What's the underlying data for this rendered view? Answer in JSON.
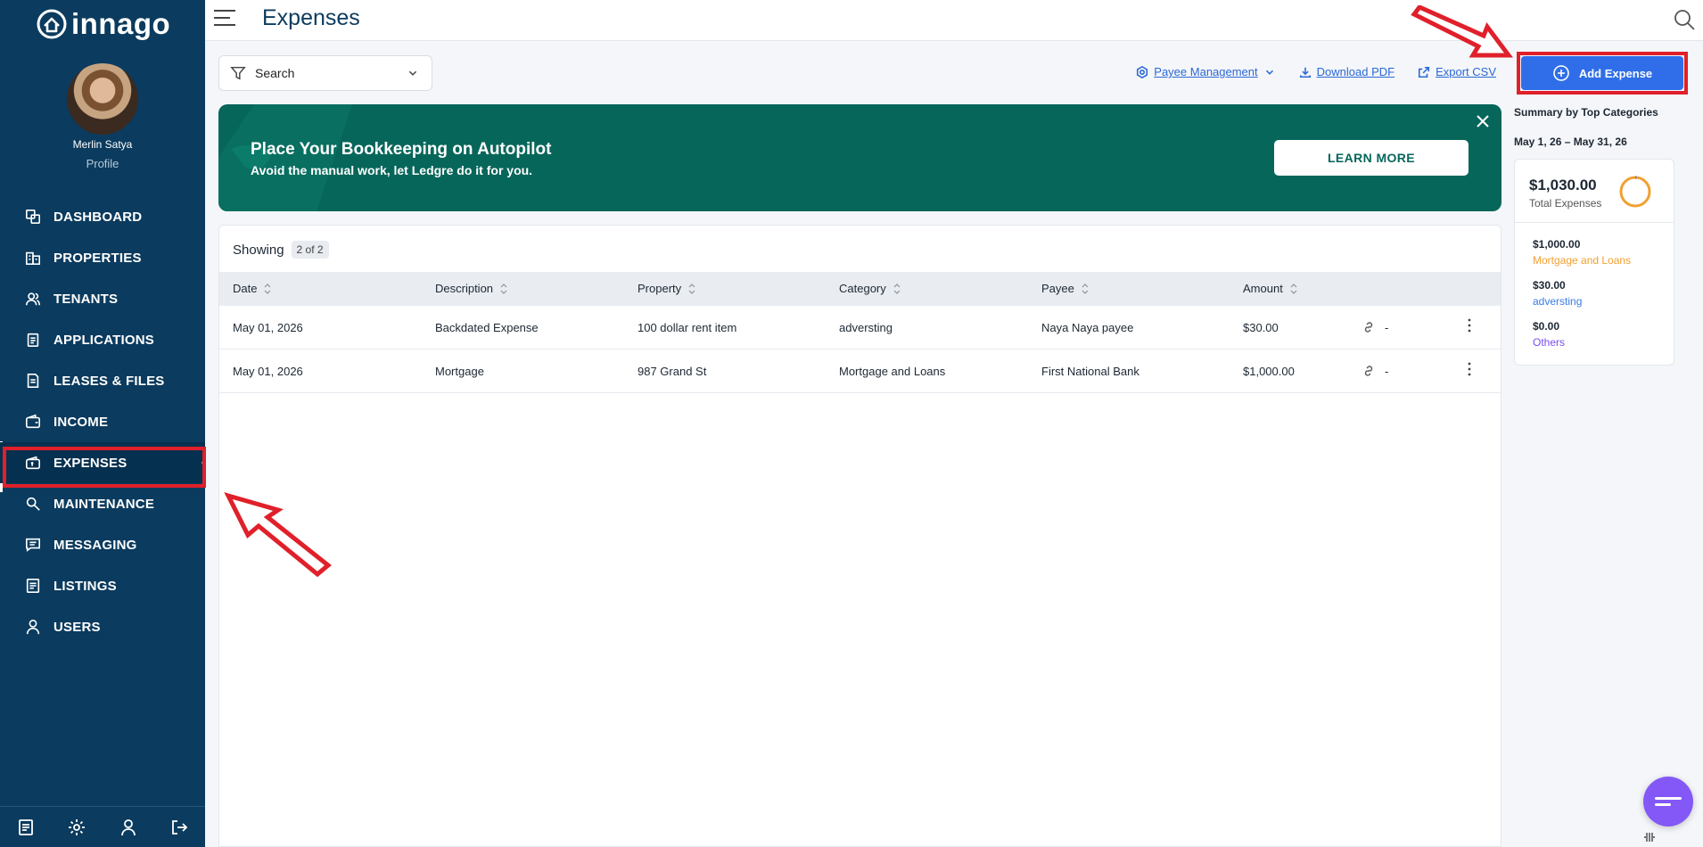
{
  "app": {
    "logo_text": "innago",
    "page_title": "Expenses"
  },
  "user": {
    "name": "Merlin Satya",
    "role": "Profile"
  },
  "nav": [
    {
      "label": "DASHBOARD",
      "icon": "dashboard-icon"
    },
    {
      "label": "PROPERTIES",
      "icon": "building-icon"
    },
    {
      "label": "TENANTS",
      "icon": "users-icon"
    },
    {
      "label": "APPLICATIONS",
      "icon": "clipboard-icon"
    },
    {
      "label": "LEASES & FILES",
      "icon": "file-icon"
    },
    {
      "label": "INCOME",
      "icon": "wallet-icon"
    },
    {
      "label": "EXPENSES",
      "icon": "expense-wallet-icon",
      "active": true
    },
    {
      "label": "MAINTENANCE",
      "icon": "wrench-icon"
    },
    {
      "label": "MESSAGING",
      "icon": "message-icon"
    },
    {
      "label": "LISTINGS",
      "icon": "list-icon"
    },
    {
      "label": "USERS",
      "icon": "user-icon"
    }
  ],
  "toolbar": {
    "search_label": "Search",
    "payee_management": "Payee Management",
    "download_pdf": "Download PDF",
    "export_csv": "Export CSV",
    "add_expense": "Add Expense"
  },
  "banner": {
    "title": "Place Your Bookkeeping on Autopilot",
    "subtitle": "Avoid the manual work, let Ledgre do it for you.",
    "button": "LEARN MORE"
  },
  "table": {
    "showing_label": "Showing",
    "count": "2 of 2",
    "columns": [
      "Date",
      "Description",
      "Property",
      "Category",
      "Payee",
      "Amount"
    ],
    "rows": [
      {
        "date": "May 01, 2026",
        "description": "Backdated Expense",
        "property": "100 dollar rent item",
        "category": "adversting",
        "payee": "Naya Naya payee",
        "amount": "$30.00",
        "link": "-"
      },
      {
        "date": "May 01, 2026",
        "description": "Mortgage",
        "property": "987 Grand St",
        "category": "Mortgage and Loans",
        "payee": "First National Bank",
        "amount": "$1,000.00",
        "link": "-"
      }
    ]
  },
  "summary": {
    "heading": "Summary by Top Categories",
    "range": "May 1, 26 – May 31, 26",
    "total": "$1,030.00",
    "total_label": "Total Expenses",
    "items": [
      {
        "amount": "$1,000.00",
        "category": "Mortgage and Loans",
        "color": "#f0a030"
      },
      {
        "amount": "$30.00",
        "category": "adversting",
        "color": "#3a7be8"
      },
      {
        "amount": "$0.00",
        "category": "Others",
        "color": "#7a4df0"
      }
    ]
  },
  "colors": {
    "sidebar": "#0b3b5e",
    "accent": "#2f6ee8",
    "banner": "#07665a",
    "annotation": "#e0202a"
  }
}
